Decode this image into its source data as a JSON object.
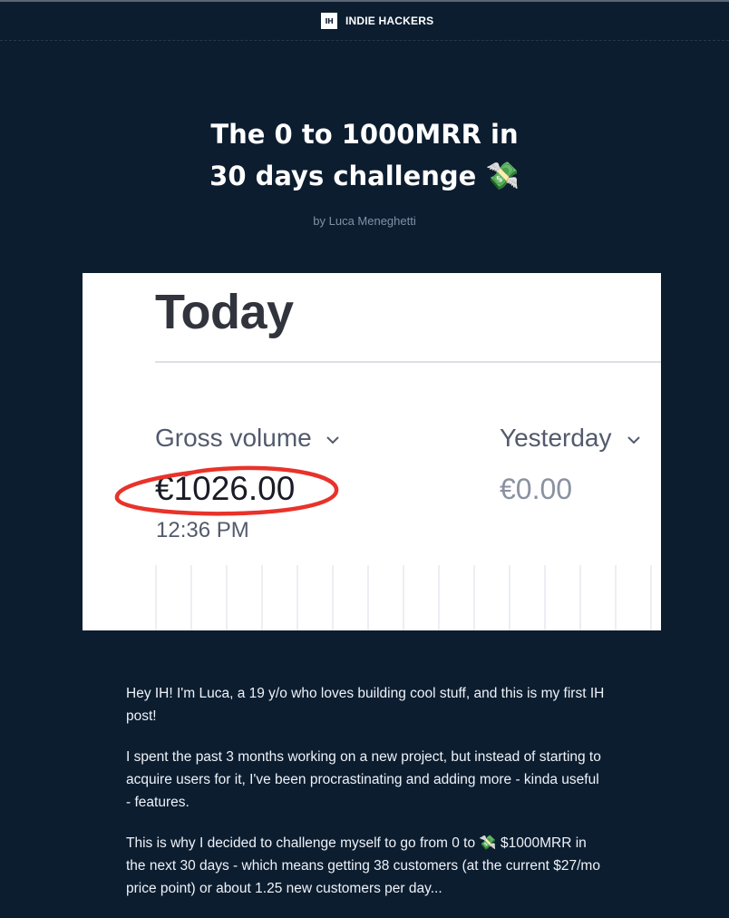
{
  "header": {
    "logo_text": "IH",
    "site_name": "INDIE HACKERS"
  },
  "post": {
    "title_line1": "The 0 to 1000MRR in",
    "title_line2": "30 days challenge",
    "title_emoji": "💸",
    "byline": "by Luca Meneghetti"
  },
  "screenshot": {
    "heading": "Today",
    "metric1_label": "Gross volume",
    "metric1_value": "€1026.00",
    "metric1_time": "12:36 PM",
    "metric2_label": "Yesterday",
    "metric2_value": "€0.00",
    "annotation_color": "#e8332a"
  },
  "body": {
    "p1": "Hey IH! I'm Luca, a 19 y/o who loves building cool stuff, and this is my first IH post!",
    "p2": "I spent the past 3 months working on a new project, but instead of starting to acquire users for it, I've been procrastinating and adding more - kinda useful - features.",
    "p3": "This is why I decided to challenge myself to go from 0 to 💸 $1000MRR in the next 30 days - which means getting 38 customers (at the current $27/mo price point) or about 1.25 new customers per day..."
  },
  "colors": {
    "background": "#0c1d30",
    "text": "#ffffff",
    "muted": "#8091a5"
  }
}
